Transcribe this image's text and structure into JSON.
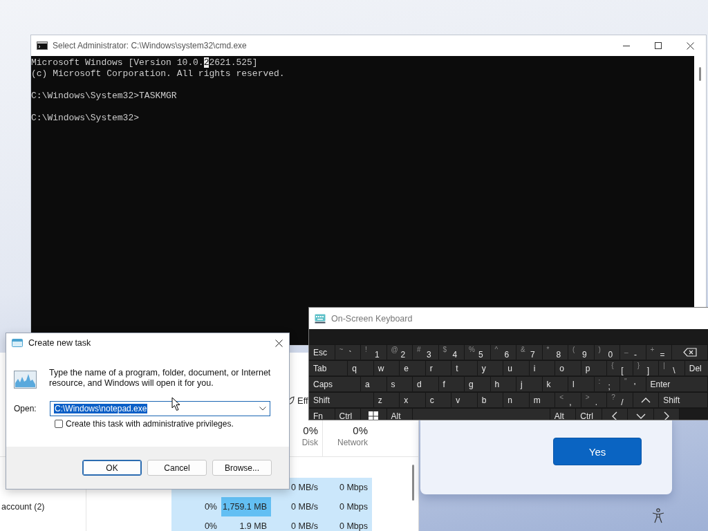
{
  "console_window": {
    "title": "Select Administrator: C:\\Windows\\system32\\cmd.exe",
    "lines": [
      {
        "blank_before": false,
        "segments": [
          {
            "text": "Microsoft Windows [Version 10.0.",
            "selected": false
          },
          {
            "text": "2",
            "selected": true
          },
          {
            "text": "2621.525]",
            "selected": false
          }
        ]
      },
      {
        "blank_before": false,
        "segments": [
          {
            "text": "(c) Microsoft Corporation. All rights reserved.",
            "selected": false
          }
        ]
      },
      {
        "blank_before": true,
        "segments": [
          {
            "text": "C:\\Windows\\System32>TASKMGR",
            "selected": false
          }
        ]
      },
      {
        "blank_before": true,
        "segments": [
          {
            "text": "C:\\Windows\\System32>",
            "selected": false
          }
        ]
      }
    ]
  },
  "task_manager": {
    "efficiency_button": "Eff",
    "columns": [
      {
        "percent": "0%",
        "label": "Disk"
      },
      {
        "percent": "0%",
        "label": "Network"
      }
    ],
    "rows": [
      {
        "disk": "0 MB/s",
        "network": "0 Mbps"
      },
      {
        "name": "account (2)",
        "cpu": "0%",
        "memory": "1,759.1 MB",
        "memory_highlighted": true,
        "disk": "0 MB/s",
        "network": "0 Mbps"
      },
      {
        "cpu": "0%",
        "memory": "1.9 MB",
        "memory_highlighted": false,
        "disk": "0 MB/s",
        "network": "0 Mbps"
      }
    ]
  },
  "confirm_panel": {
    "button": "Yes"
  },
  "run_dialog": {
    "title": "Create new task",
    "message": "Type the name of a program, folder, document, or Internet resource, and Windows will open it for you.",
    "open_label": "Open:",
    "value": "C:\\Windows\\notepad.exe",
    "value_selected": true,
    "admin_checkbox": {
      "label": "Create this task with administrative privileges.",
      "checked": false
    },
    "buttons": [
      {
        "label": "OK",
        "default": true
      },
      {
        "label": "Cancel",
        "default": false
      },
      {
        "label": "Browse...",
        "default": false
      }
    ]
  },
  "keyboard": {
    "title": "On-Screen Keyboard",
    "rows": [
      {
        "keys": [
          {
            "kind": "key",
            "label": "Esc"
          },
          {
            "kind": "key",
            "label": "`",
            "shift": "~"
          },
          {
            "kind": "key",
            "label": "1",
            "shift": "!"
          },
          {
            "kind": "key",
            "label": "2",
            "shift": "@"
          },
          {
            "kind": "key",
            "label": "3",
            "shift": "#"
          },
          {
            "kind": "key",
            "label": "4",
            "shift": "$"
          },
          {
            "kind": "key",
            "label": "5",
            "shift": "%"
          },
          {
            "kind": "key",
            "label": "6",
            "shift": "^"
          },
          {
            "kind": "key",
            "label": "7",
            "shift": "&"
          },
          {
            "kind": "key",
            "label": "8",
            "shift": "*"
          },
          {
            "kind": "key",
            "label": "9",
            "shift": "("
          },
          {
            "kind": "key",
            "label": "0",
            "shift": ")"
          },
          {
            "kind": "key",
            "label": "-",
            "shift": "_"
          },
          {
            "kind": "key",
            "label": "=",
            "shift": "+"
          },
          {
            "kind": "backspace"
          }
        ]
      },
      {
        "keys": [
          {
            "kind": "tab",
            "label": "Tab"
          },
          {
            "kind": "key",
            "label": "q"
          },
          {
            "kind": "key",
            "label": "w"
          },
          {
            "kind": "key",
            "label": "e"
          },
          {
            "kind": "key",
            "label": "r"
          },
          {
            "kind": "key",
            "label": "t"
          },
          {
            "kind": "key",
            "label": "y"
          },
          {
            "kind": "key",
            "label": "u"
          },
          {
            "kind": "key",
            "label": "i"
          },
          {
            "kind": "key",
            "label": "o"
          },
          {
            "kind": "key",
            "label": "p"
          },
          {
            "kind": "key",
            "label": "[",
            "shift": "{"
          },
          {
            "kind": "key",
            "label": "]",
            "shift": "}"
          },
          {
            "kind": "key",
            "label": "\\",
            "shift": "|"
          },
          {
            "kind": "key",
            "label": "Del"
          }
        ]
      },
      {
        "keys": [
          {
            "kind": "caps",
            "label": "Caps"
          },
          {
            "kind": "key",
            "label": "a"
          },
          {
            "kind": "key",
            "label": "s"
          },
          {
            "kind": "key",
            "label": "d"
          },
          {
            "kind": "key",
            "label": "f"
          },
          {
            "kind": "key",
            "label": "g"
          },
          {
            "kind": "key",
            "label": "h"
          },
          {
            "kind": "key",
            "label": "j"
          },
          {
            "kind": "key",
            "label": "k"
          },
          {
            "kind": "key",
            "label": "l"
          },
          {
            "kind": "key",
            "label": ";",
            "shift": ":"
          },
          {
            "kind": "key",
            "label": "'",
            "shift": "\""
          },
          {
            "kind": "fill",
            "label": "Enter"
          }
        ]
      },
      {
        "keys": [
          {
            "kind": "lshift",
            "label": "Shift"
          },
          {
            "kind": "key",
            "label": "z"
          },
          {
            "kind": "key",
            "label": "x"
          },
          {
            "kind": "key",
            "label": "c"
          },
          {
            "kind": "key",
            "label": "v"
          },
          {
            "kind": "key",
            "label": "b"
          },
          {
            "kind": "key",
            "label": "n"
          },
          {
            "kind": "key",
            "label": "m"
          },
          {
            "kind": "key",
            "label": ",",
            "shift": "<"
          },
          {
            "kind": "key",
            "label": ".",
            "shift": ">"
          },
          {
            "kind": "key",
            "label": "/",
            "shift": "?"
          },
          {
            "kind": "up"
          },
          {
            "kind": "fill",
            "label": "Shift"
          }
        ]
      },
      {
        "keys": [
          {
            "kind": "key",
            "label": "Fn"
          },
          {
            "kind": "key",
            "label": "Ctrl"
          },
          {
            "kind": "win"
          },
          {
            "kind": "key",
            "label": "Alt"
          },
          {
            "kind": "space"
          },
          {
            "kind": "key",
            "label": "Alt"
          },
          {
            "kind": "key",
            "label": "Ctrl"
          },
          {
            "kind": "left"
          },
          {
            "kind": "down"
          },
          {
            "kind": "right"
          }
        ]
      }
    ]
  }
}
